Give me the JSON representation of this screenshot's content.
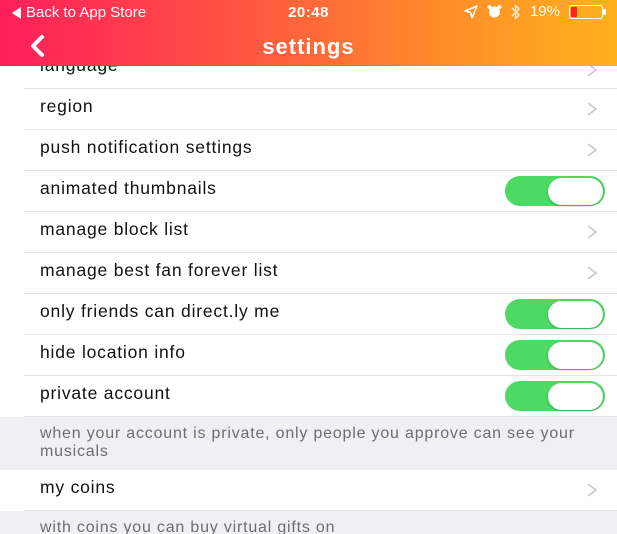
{
  "status_bar": {
    "back_text": "Back to App Store",
    "time": "20:48",
    "battery": "19%",
    "battery_level": 0.19,
    "icons": [
      "location-arrow-icon",
      "alarm-icon",
      "bluetooth-icon",
      "battery-icon"
    ]
  },
  "nav": {
    "title": "settings",
    "back_icon": "chevron-left-icon"
  },
  "colors": {
    "header_gradient": [
      "#ff1e5a",
      "#ff8a2a",
      "#ffb21c"
    ],
    "toggle_on": "#4cd964",
    "note_background": "#efeff4"
  },
  "items": [
    {
      "label": "language",
      "control": "chevron"
    },
    {
      "label": "region",
      "control": "chevron"
    },
    {
      "label": "push notification settings",
      "control": "chevron"
    },
    {
      "label": "animated thumbnails",
      "control": "toggle",
      "on": true
    },
    {
      "label": "manage block list",
      "control": "chevron"
    },
    {
      "label": "manage best fan forever list",
      "control": "chevron"
    },
    {
      "label": "only friends can direct.ly me",
      "control": "toggle",
      "on": true
    },
    {
      "label": "hide location info",
      "control": "toggle",
      "on": true
    },
    {
      "label": "private account",
      "control": "toggle",
      "on": true
    }
  ],
  "private_note": "when your account is private, only people you approve can see your musicals",
  "coins": {
    "label": "my coins",
    "control": "chevron"
  },
  "coins_note": "with coins you can buy virtual gifts on"
}
